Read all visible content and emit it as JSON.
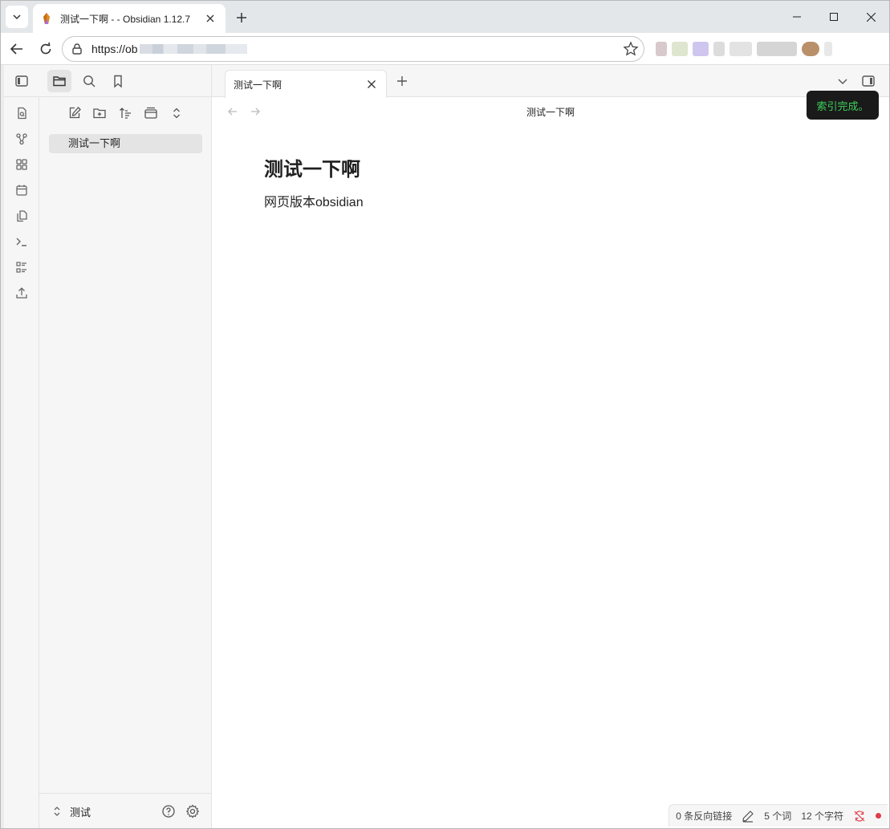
{
  "browser": {
    "tab_title": "测试一下啊 - - Obsidian 1.12.7",
    "url_visible": "https://ob"
  },
  "sidebar": {
    "files": [
      {
        "name": "测试一下啊"
      }
    ],
    "vault_name": "测试"
  },
  "editor": {
    "tab_title": "测试一下啊",
    "view_title": "测试一下啊",
    "heading": "测试一下啊",
    "body": "网页版本obsidian"
  },
  "notice": {
    "text": "索引完成。"
  },
  "status_bar": {
    "backlinks": "0 条反向链接",
    "words": "5 个词",
    "chars": "12 个字符"
  },
  "colors": {
    "notice_bg": "#1a1a1a",
    "notice_text": "#3ecf5a",
    "sync_dot": "#e03b4a",
    "active_file_bg": "#e4e4e4"
  }
}
